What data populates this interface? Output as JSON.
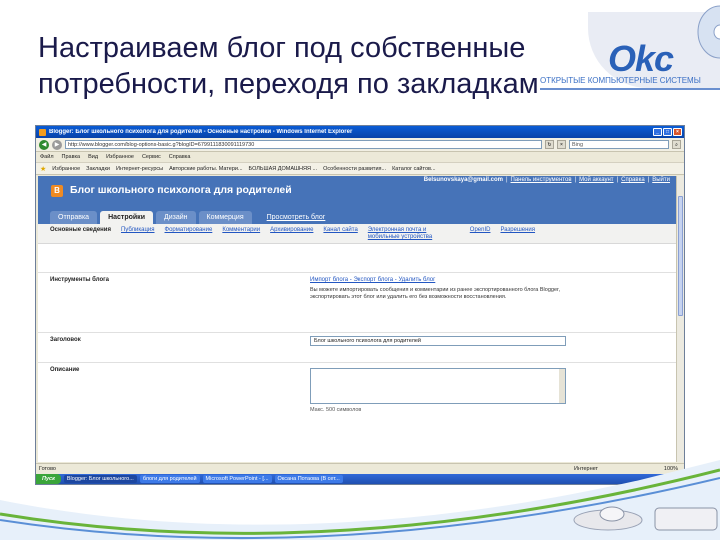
{
  "slide": {
    "title_line1": "Настраиваем блог под собственные",
    "title_line2": "потребности, переходя по закладкам"
  },
  "logo": {
    "text": "Okc",
    "subtitle": "ОТКРЫТЫЕ КОМПЬЮТЕРНЫЕ СИСТЕМЫ"
  },
  "browser": {
    "window_title": "Blogger: Блог школьного психолога для родителей - Основные настройки - Windows Internet Explorer",
    "url": "http://www.blogger.com/blog-options-basic.g?blogID=6799111830091119730",
    "search_placeholder": "Bing",
    "menu": [
      "Файл",
      "Правка",
      "Вид",
      "Избранное",
      "Сервис",
      "Справка"
    ],
    "favorites": [
      "Избранное",
      "Закладки",
      "Интернет-ресурсы",
      "Авторские работы. Матери...",
      "БОЛЬШАЯ ДОМАШНЯЯ ...",
      "Особенности развития...",
      "Каталог сайтов..."
    ],
    "status_left": "Готово",
    "status_zone": "Интернет",
    "zoom": "100%"
  },
  "blogger": {
    "logo_letter": "B",
    "blog_title": "Блог школьного психолога для родителей",
    "header_links": [
      "Belsunovskaya@gmail.com",
      "|",
      "Панель инструментов",
      "|",
      "Мой аккаунт",
      "|",
      "Справка",
      "|",
      "Выйти"
    ],
    "tabs": [
      "Отправка",
      "Настройки",
      "Дизайн",
      "Коммерция"
    ],
    "view_blog": "Просмотреть блог",
    "subtabs": [
      "Основные сведения",
      "Публикация",
      "Форматирование",
      "Комментарии",
      "Архивирование",
      "Канал сайта",
      "Электронная почта и мобильные устройства",
      "OpenID",
      "Разрешения"
    ],
    "tools_label": "Инструменты блога",
    "tools_links": "Импорт блога - Экспорт блога - Удалить блог",
    "tools_desc": "Вы можете импортировать сообщения и комментарии из ранее экспортированного блога Blogger, экспортировать этот блог или удалить его без возможности восстановления.",
    "title_label": "Заголовок",
    "title_value": "Блог школьного психолога для родителей",
    "desc_label": "Описание",
    "desc_hint": "Макс. 500 символов"
  },
  "taskbar": {
    "start": "Пуск",
    "tasks": [
      "Blogger: Блог школьного...",
      "блоги для родителей",
      "Microsoft PowerPoint - [...",
      "Оксана Потаова (В сет..."
    ],
    "clock": "1:07"
  },
  "colors": {
    "blogger_header": "#4673b8",
    "blogger_orange": "#ef8a22",
    "link": "#2256c2",
    "title_text": "#1a1a4a"
  }
}
